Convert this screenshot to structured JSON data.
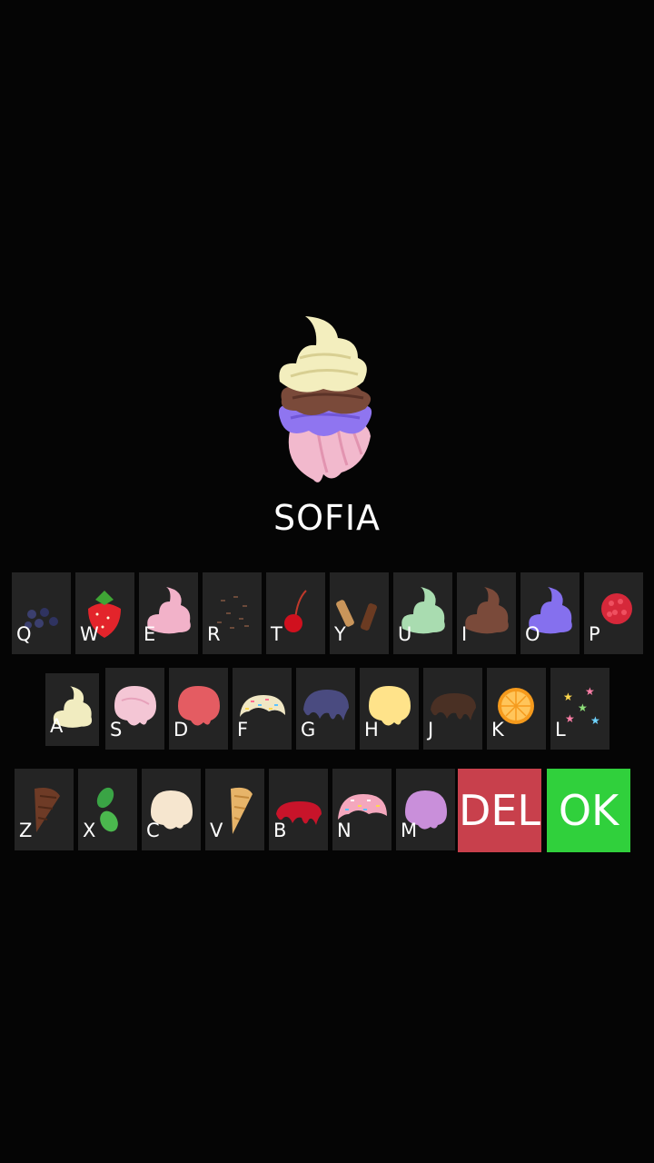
{
  "player_name": "SOFIA",
  "keyboard": {
    "row1": [
      {
        "letter": "Q",
        "topping": "blueberries-icon"
      },
      {
        "letter": "W",
        "topping": "strawberry-icon"
      },
      {
        "letter": "E",
        "topping": "pink-swirl-icon"
      },
      {
        "letter": "R",
        "topping": "chocolate-sprinkles-icon"
      },
      {
        "letter": "T",
        "topping": "cherry-icon"
      },
      {
        "letter": "Y",
        "topping": "wafer-rolls-icon"
      },
      {
        "letter": "U",
        "topping": "mint-swirl-icon"
      },
      {
        "letter": "I",
        "topping": "chocolate-swirl-icon"
      },
      {
        "letter": "O",
        "topping": "purple-swirl-icon"
      },
      {
        "letter": "P",
        "topping": "raspberry-icon"
      }
    ],
    "row2": [
      {
        "letter": "A",
        "topping": "vanilla-swirl-icon"
      },
      {
        "letter": "S",
        "topping": "pink-scoop-icon"
      },
      {
        "letter": "D",
        "topping": "red-scoop-icon"
      },
      {
        "letter": "F",
        "topping": "sprinkle-scoop-icon"
      },
      {
        "letter": "G",
        "topping": "blueberry-syrup-icon"
      },
      {
        "letter": "H",
        "topping": "lemon-scoop-icon"
      },
      {
        "letter": "J",
        "topping": "chocolate-syrup-icon"
      },
      {
        "letter": "K",
        "topping": "orange-slice-icon"
      },
      {
        "letter": "L",
        "topping": "star-sprinkles-icon"
      }
    ],
    "row3": [
      {
        "letter": "Z",
        "topping": "chocolate-cone-icon"
      },
      {
        "letter": "X",
        "topping": "mint-leaves-icon"
      },
      {
        "letter": "C",
        "topping": "cream-scoop-icon"
      },
      {
        "letter": "V",
        "topping": "waffle-cone-icon"
      },
      {
        "letter": "B",
        "topping": "strawberry-syrup-icon"
      },
      {
        "letter": "N",
        "topping": "pink-sprinkle-scoop-icon"
      },
      {
        "letter": "M",
        "topping": "lilac-scoop-icon"
      }
    ],
    "del_label": "DEL",
    "ok_label": "OK"
  },
  "colors": {
    "background": "#050505",
    "key_background": "#242424",
    "delete": "#c8404c",
    "ok": "#30d03c"
  }
}
